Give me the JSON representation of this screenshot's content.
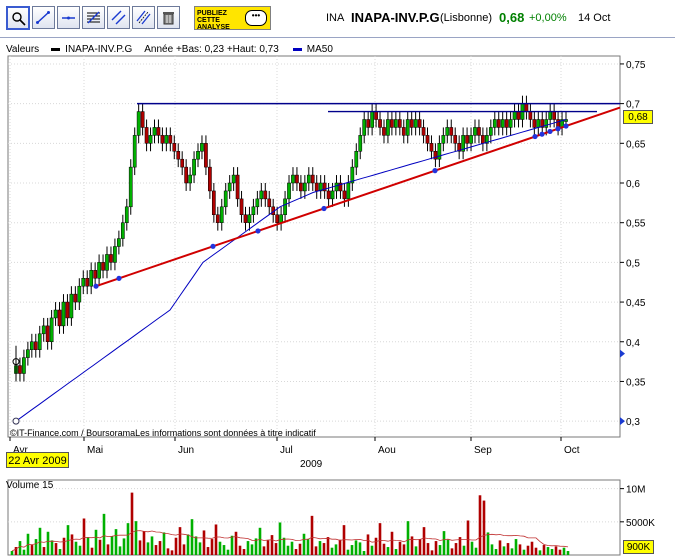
{
  "toolbar": {
    "icons": [
      "crosshair-zoom-icon",
      "trendline-icon",
      "horizontal-line-icon",
      "fibonacci-icon",
      "parallel-lines-icon",
      "channel-icon",
      "trash-icon"
    ],
    "publish_line1": "PUBLIEZ",
    "publish_line2": "CETTE",
    "publish_line3": "ANALYSE"
  },
  "header": {
    "ticker": "INA",
    "name": "INAPA-INV.P.G",
    "market": "(Lisbonne)",
    "price": "0,68",
    "change": "+0,00%",
    "date": "14 Oct"
  },
  "legend": {
    "label": "Valeurs",
    "series_name": "INAPA-INV.P.G",
    "range_text": "Année +Bas: 0,23 +Haut: 0,73",
    "ma_name": "MA50"
  },
  "date_box": "22 Avr 2009",
  "price_box": "0,68",
  "volume_box": "900K",
  "copyright": "©IT-Finance.com / BoursoramaLes informations sont données à titre indicatif",
  "volume_title": "Volume 15",
  "colors": {
    "up": "#00b000",
    "down": "#b00000",
    "ma": "#0000c0",
    "trend": "#d00000",
    "resistance": "#00008b"
  },
  "chart_data": [
    {
      "type": "candlestick",
      "title": "INAPA-INV.P.G",
      "x_ticks": [
        "Avr",
        "Mai",
        "Jun",
        "Jul",
        "Aou",
        "Sep",
        "Oct"
      ],
      "x_year": "2009",
      "y_ticks": [
        "0,75",
        "0,7",
        "0,65",
        "0,6",
        "0,55",
        "0,5",
        "0,45",
        "0,4",
        "0,35",
        "0,3"
      ],
      "ylim": [
        0.28,
        0.76
      ],
      "close": [
        0.37,
        0.36,
        0.38,
        0.39,
        0.4,
        0.39,
        0.41,
        0.42,
        0.4,
        0.43,
        0.44,
        0.42,
        0.45,
        0.43,
        0.46,
        0.45,
        0.47,
        0.48,
        0.47,
        0.49,
        0.48,
        0.5,
        0.49,
        0.51,
        0.5,
        0.52,
        0.53,
        0.55,
        0.57,
        0.62,
        0.66,
        0.69,
        0.67,
        0.65,
        0.66,
        0.67,
        0.66,
        0.65,
        0.66,
        0.65,
        0.64,
        0.63,
        0.62,
        0.6,
        0.61,
        0.63,
        0.64,
        0.65,
        0.62,
        0.59,
        0.56,
        0.55,
        0.57,
        0.59,
        0.6,
        0.61,
        0.58,
        0.56,
        0.55,
        0.56,
        0.57,
        0.58,
        0.59,
        0.58,
        0.57,
        0.56,
        0.55,
        0.56,
        0.58,
        0.6,
        0.61,
        0.6,
        0.59,
        0.6,
        0.61,
        0.6,
        0.59,
        0.6,
        0.59,
        0.58,
        0.59,
        0.6,
        0.59,
        0.58,
        0.6,
        0.62,
        0.64,
        0.66,
        0.68,
        0.67,
        0.69,
        0.68,
        0.67,
        0.66,
        0.68,
        0.67,
        0.68,
        0.67,
        0.66,
        0.68,
        0.67,
        0.68,
        0.67,
        0.66,
        0.65,
        0.64,
        0.63,
        0.65,
        0.66,
        0.67,
        0.66,
        0.65,
        0.64,
        0.66,
        0.65,
        0.66,
        0.67,
        0.66,
        0.65,
        0.66,
        0.67,
        0.68,
        0.67,
        0.68,
        0.67,
        0.68,
        0.69,
        0.68,
        0.7,
        0.69,
        0.68,
        0.67,
        0.68,
        0.67,
        0.68,
        0.69,
        0.68,
        0.67,
        0.68,
        0.68
      ],
      "ma50": [
        0.3,
        0.305,
        0.31,
        0.315,
        0.32,
        0.325,
        0.33,
        0.335,
        0.34,
        0.345,
        0.35,
        0.355,
        0.36,
        0.365,
        0.37,
        0.375,
        0.38,
        0.385,
        0.39,
        0.395,
        0.4,
        0.405,
        0.41,
        0.415,
        0.42,
        0.425,
        0.43,
        0.435,
        0.44,
        0.45,
        0.46,
        0.47,
        0.48,
        0.49,
        0.5,
        0.505,
        0.51,
        0.515,
        0.52,
        0.525,
        0.53,
        0.535,
        0.54,
        0.545,
        0.55,
        0.555,
        0.56,
        0.565,
        0.57,
        0.573,
        0.576,
        0.579,
        0.582,
        0.585,
        0.588,
        0.59,
        0.592,
        0.594,
        0.596,
        0.598,
        0.6,
        0.602,
        0.604,
        0.606,
        0.608,
        0.61,
        0.612,
        0.614,
        0.616,
        0.618,
        0.62,
        0.622,
        0.624,
        0.626,
        0.628,
        0.63,
        0.632,
        0.634,
        0.636,
        0.638,
        0.64,
        0.642,
        0.644,
        0.646,
        0.648,
        0.65,
        0.652,
        0.654,
        0.656,
        0.658,
        0.66,
        0.662,
        0.664,
        0.666,
        0.668,
        0.67,
        0.672,
        0.674,
        0.676,
        0.678,
        0.68
      ],
      "annotations": [
        "resistance 0,70",
        "rising support trendline"
      ]
    },
    {
      "type": "bar",
      "title": "Volume 15",
      "y_ticks": [
        "10M",
        "5000K"
      ],
      "values": [
        0.6,
        1.2,
        2.1,
        0.8,
        3.2,
        1.5,
        2.4,
        4.1,
        1.2,
        3.5,
        2.2,
        1.8,
        0.9,
        2.6,
        4.5,
        3.1,
        2.0,
        1.4,
        5.5,
        2.7,
        1.1,
        3.8,
        2.3,
        6.2,
        1.6,
        2.8,
        3.9,
        1.3,
        2.5,
        4.8,
        9.4,
        5.1,
        2.2,
        3.6,
        1.9,
        2.8,
        1.5,
        2.1,
        3.4,
        1.0,
        0.7,
        2.6,
        4.2,
        1.6,
        3.1,
        5.4,
        2.8,
        1.9,
        3.7,
        1.2,
        2.4,
        4.6,
        2.0,
        1.5,
        0.8,
        2.9,
        3.5,
        1.4,
        0.9,
        2.1,
        1.6,
        2.5,
        4.1,
        1.3,
        2.2,
        3.0,
        1.8,
        4.9,
        2.6,
        1.4,
        2.0,
        0.9,
        1.7,
        3.2,
        2.4,
        5.9,
        1.3,
        2.1,
        1.8,
        2.7,
        1.1,
        1.6,
        2.3,
        4.5,
        0.8,
        1.5,
        2.2,
        1.9,
        0.6,
        3.1,
        1.4,
        2.6,
        4.8,
        1.7,
        1.2,
        3.5,
        0.9,
        2.0,
        1.6,
        5.1,
        2.8,
        1.3,
        2.4,
        4.2,
        1.8,
        0.7,
        2.1,
        1.5,
        3.6,
        2.3,
        1.0,
        1.8,
        2.7,
        1.4,
        5.2,
        2.0,
        1.1,
        9.0,
        8.2,
        3.4,
        1.6,
        0.9,
        2.2,
        1.3,
        1.8,
        1.0,
        2.4,
        1.6,
        0.8,
        1.4,
        2.0,
        1.1,
        0.7,
        1.5,
        1.2,
        0.9,
        1.3,
        0.8,
        1.1,
        0.6
      ],
      "up": [
        1,
        0,
        1,
        1,
        1,
        0,
        1,
        1,
        0,
        1,
        1,
        0,
        1,
        0,
        1,
        0,
        1,
        1,
        0,
        1,
        0,
        1,
        0,
        1,
        0,
        1,
        1,
        1,
        1,
        1,
        0,
        1,
        0,
        0,
        1,
        1,
        0,
        0,
        1,
        0,
        0,
        0,
        0,
        0,
        1,
        1,
        1,
        1,
        0,
        0,
        0,
        0,
        1,
        1,
        1,
        1,
        0,
        0,
        0,
        1,
        1,
        1,
        1,
        0,
        0,
        0,
        0,
        1,
        1,
        1,
        1,
        0,
        0,
        1,
        1,
        0,
        0,
        1,
        0,
        0,
        1,
        1,
        0,
        0,
        1,
        1,
        1,
        1,
        1,
        0,
        1,
        0,
        0,
        0,
        1,
        0,
        1,
        0,
        0,
        1,
        0,
        1,
        0,
        0,
        0,
        0,
        0,
        1,
        1,
        1,
        0,
        0,
        0,
        1,
        0,
        1,
        1,
        0,
        0,
        1,
        1,
        1,
        0,
        1,
        0,
        1,
        1,
        0,
        1,
        0,
        0,
        0,
        1,
        0,
        1,
        1,
        0,
        0,
        1,
        1
      ]
    }
  ]
}
